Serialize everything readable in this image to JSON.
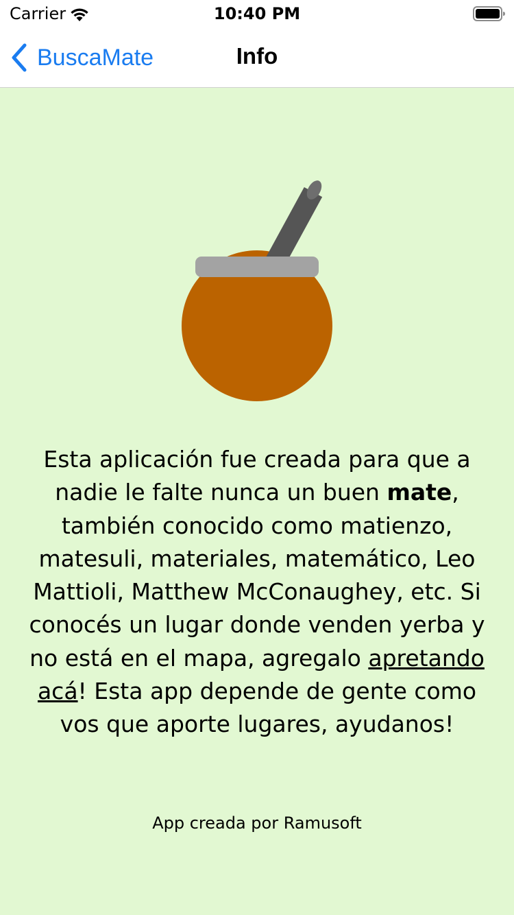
{
  "status_bar": {
    "carrier": "Carrier",
    "time": "10:40 PM",
    "wifi_icon": "wifi-icon",
    "battery_icon": "battery-icon"
  },
  "nav": {
    "back_label": "BuscaMate",
    "back_icon": "chevron-left-icon",
    "title": "Info"
  },
  "illustration": {
    "icon": "mate-gourd-icon"
  },
  "description": {
    "part1": "Esta aplicación fue creada para que a nadie le falte nunca un buen ",
    "bold_word": "mate",
    "part2": ", también conocido como matienzo, matesuli, materiales, matemático, Leo Mattioli, Matthew McConaughey, etc. Si conocés un lugar donde venden yerba y no está en el mapa, agregalo ",
    "link_text": "apretando acá",
    "part3": "! Esta app depende de gente como vos que aporte lugares, ayudanos!"
  },
  "credits": "App creada por Ramusoft",
  "colors": {
    "background": "#e2f8d2",
    "accent": "#1a7cf0",
    "gourd": "#bb6300",
    "rim": "#a3a3a3",
    "straw": "#555555"
  }
}
